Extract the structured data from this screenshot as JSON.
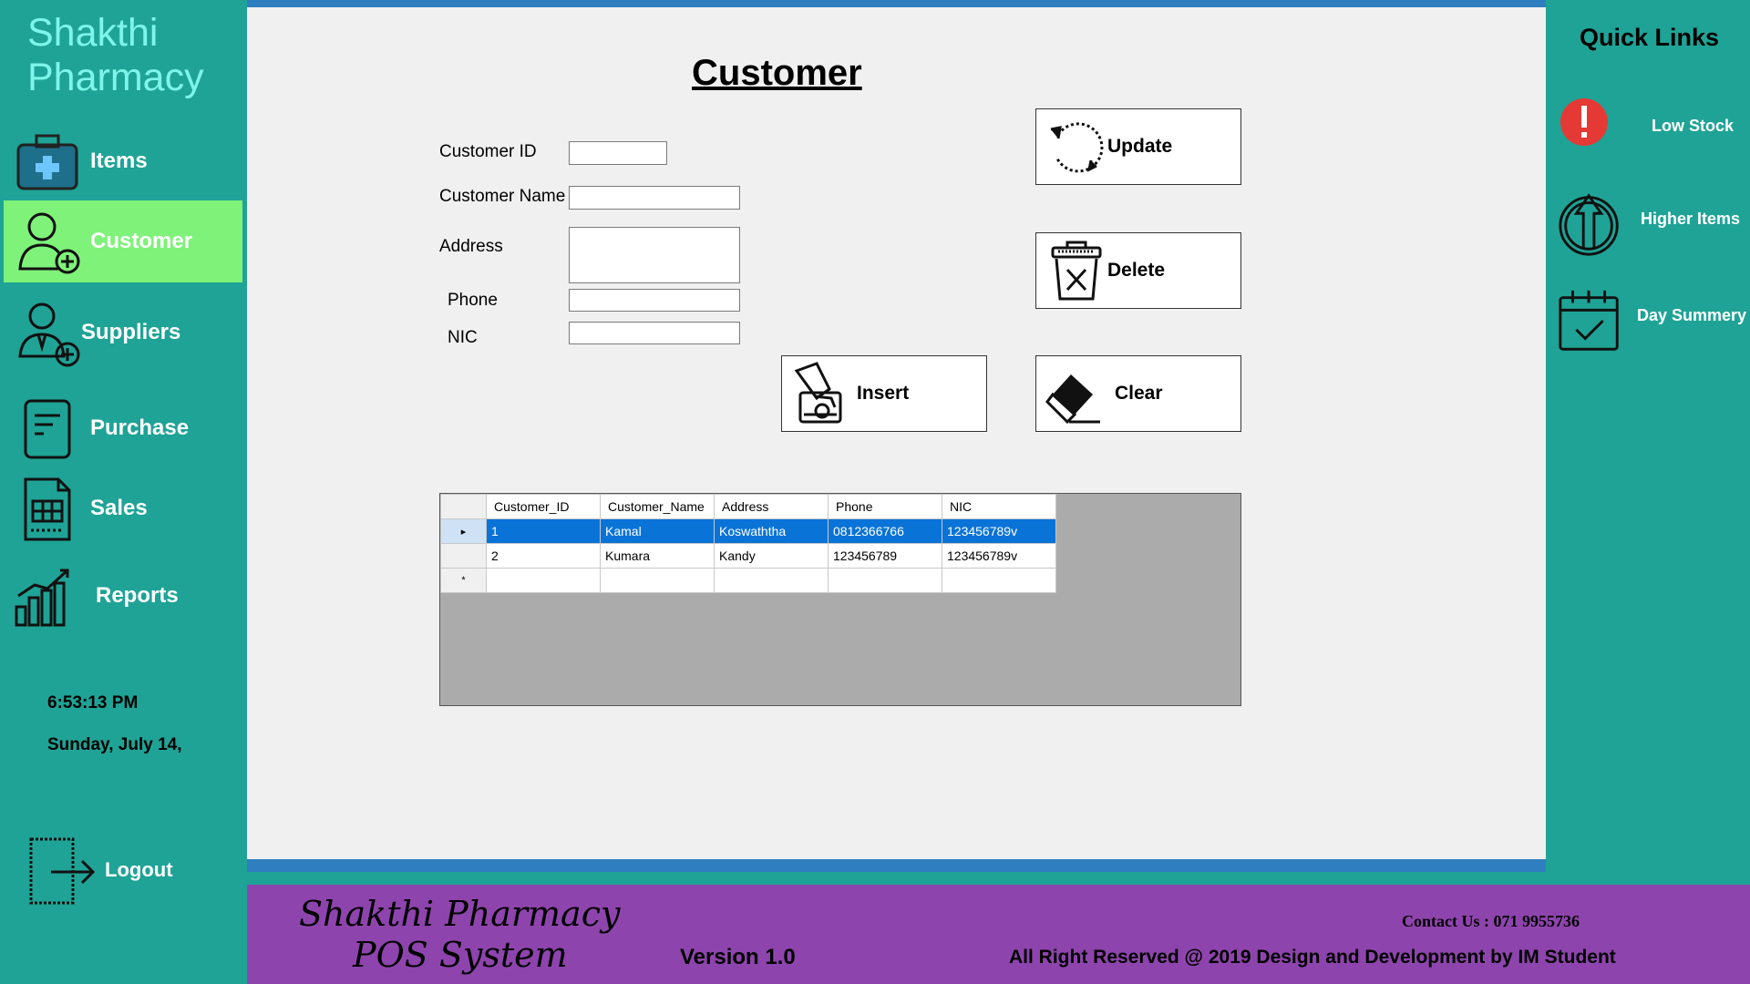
{
  "app": {
    "brand_line1": "Shakthi",
    "brand_line2": "Pharmacy"
  },
  "sidebar": {
    "items": [
      {
        "label": "Items",
        "icon": "medical-kit-icon"
      },
      {
        "label": "Customer",
        "icon": "customer-add-icon",
        "active": true
      },
      {
        "label": "Suppliers",
        "icon": "supplier-add-icon"
      },
      {
        "label": "Purchase",
        "icon": "purchase-document-icon"
      },
      {
        "label": "Sales",
        "icon": "sales-receipt-icon"
      },
      {
        "label": "Reports",
        "icon": "bar-chart-icon"
      }
    ],
    "time": "6:53:13 PM",
    "date": "Sunday, July 14,",
    "logout_label": "Logout",
    "active_color": "#7ff27a"
  },
  "form": {
    "title": "Customer",
    "customer_id_label": "Customer ID",
    "customer_name_label": "Customer Name",
    "address_label": "Address",
    "phone_label": "Phone",
    "nic_label": "NIC",
    "customer_id_value": "",
    "customer_name_value": "",
    "address_value": "",
    "phone_value": "",
    "nic_value": ""
  },
  "actions": {
    "update_label": "Update",
    "delete_label": "Delete",
    "insert_label": "Insert",
    "clear_label": "Clear"
  },
  "grid": {
    "columns": [
      "Customer_ID",
      "Customer_Name",
      "Address",
      "Phone",
      "NIC"
    ],
    "rows": [
      [
        "1",
        "Kamal",
        "Koswaththa",
        "0812366766",
        "123456789v"
      ],
      [
        "2",
        "Kumara",
        "Kandy",
        "123456789",
        "123456789v"
      ]
    ],
    "selected_row_marker": "▸",
    "new_row_marker": "*"
  },
  "quick_links": {
    "title": "Quick Links",
    "items": [
      {
        "label": "Low Stock",
        "icon": "alert-icon"
      },
      {
        "label": "Higher Items",
        "icon": "arrow-up-circle-icon"
      },
      {
        "label": "Day Summery",
        "icon": "calendar-check-icon"
      }
    ]
  },
  "footer": {
    "script_line1": "Shakthi Pharmacy",
    "script_line2": "POS System",
    "version": "Version 1.0",
    "contact": "Contact Us : 071 9955736",
    "rights": "All Right Reserved @ 2019 Design and Development by IM Student"
  },
  "colors": {
    "sidebar_bg": "#1fa396",
    "footer_bg": "#8e44ad",
    "accent_blue": "#2f7fc0",
    "selection_blue": "#0a73d7",
    "alert_red": "#e53935"
  }
}
